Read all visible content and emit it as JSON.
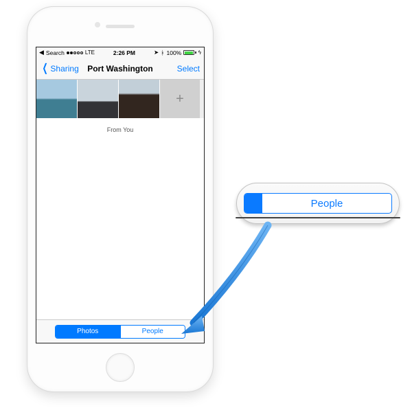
{
  "status_bar": {
    "back_to_app": "Search",
    "carrier_dots_filled": 2,
    "carrier_dots_total": 5,
    "network": "LTE",
    "time": "2:26 PM",
    "location_icon": "location-icon",
    "bluetooth_icon": "bluetooth-icon",
    "battery_percent": "100%"
  },
  "navbar": {
    "back_label": "Sharing",
    "title": "Port Washington",
    "action_label": "Select"
  },
  "photo_strip": {
    "thumbs": [
      "sea",
      "cloudy",
      "building"
    ],
    "add_label": "+"
  },
  "from_label": "From You",
  "segmented": {
    "option_a": "Photos",
    "option_b": "People",
    "active": "Photos"
  },
  "callout": {
    "label": "People"
  }
}
